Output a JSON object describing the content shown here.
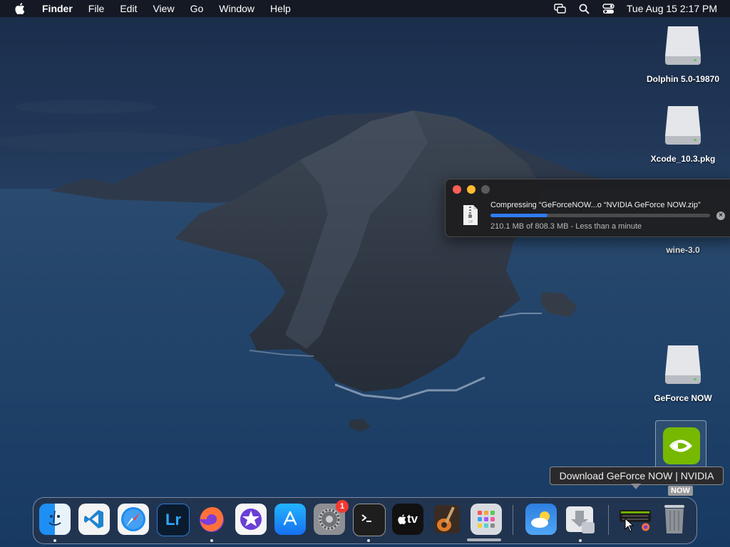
{
  "menubar": {
    "app_name": "Finder",
    "menus": [
      "File",
      "Edit",
      "View",
      "Go",
      "Window",
      "Help"
    ],
    "clock": "Tue Aug 15  2:17 PM",
    "status_icons": [
      "screen-mirroring-icon",
      "spotlight-search-icon",
      "control-center-icon"
    ]
  },
  "desktop": {
    "icons": [
      {
        "label": "Dolphin 5.0-19870",
        "icon": "disk-image-icon"
      },
      {
        "label": "Xcode_10.3.pkg",
        "icon": "disk-image-icon"
      },
      {
        "label": "wine-3.0",
        "icon": "disk-image-icon"
      },
      {
        "label": "GeForce NOW",
        "icon": "disk-image-icon"
      }
    ],
    "selected_app": {
      "badge": "NOW",
      "icon": "nvidia-geforce-now-icon"
    }
  },
  "compress_window": {
    "title": "Compressing “GeForceNOW...o “NVIDIA GeForce NOW.zip”",
    "status": "210.1 MB of 808.3 MB - Less than a minute",
    "progress_fraction": 0.26,
    "accent": "#2f7cf6"
  },
  "tooltip": {
    "text": "Download GeForce NOW | NVIDIA"
  },
  "dock": {
    "apps": [
      {
        "name": "Finder",
        "icon": "finder-icon",
        "running": true
      },
      {
        "name": "Visual Studio Code",
        "icon": "vscode-icon",
        "running": false
      },
      {
        "name": "Safari",
        "icon": "safari-icon",
        "running": false
      },
      {
        "name": "Lightroom",
        "icon": "lightroom-icon",
        "label": "Lr",
        "running": false
      },
      {
        "name": "Firefox",
        "icon": "firefox-icon",
        "running": true
      },
      {
        "name": "iMovie",
        "icon": "imovie-icon",
        "running": false
      },
      {
        "name": "App Store",
        "icon": "app-store-icon",
        "running": false
      },
      {
        "name": "System Preferences",
        "icon": "system-preferences-icon",
        "badge": "1",
        "running": false
      },
      {
        "name": "Terminal",
        "icon": "terminal-icon",
        "running": true
      },
      {
        "name": "Apple TV",
        "icon": "apple-tv-icon",
        "label": "tv",
        "running": false
      },
      {
        "name": "GarageBand",
        "icon": "garageband-icon",
        "running": false
      },
      {
        "name": "Launchpad",
        "icon": "launchpad-icon",
        "running": false
      },
      {
        "name": "Weather",
        "icon": "weather-icon",
        "running": false
      },
      {
        "name": "Downloads",
        "icon": "downloads-stack-icon",
        "running": true
      },
      {
        "name": "GeForce NOW Installer",
        "icon": "installer-stack-icon",
        "running": false
      },
      {
        "name": "Trash",
        "icon": "trash-icon",
        "running": false
      }
    ]
  }
}
